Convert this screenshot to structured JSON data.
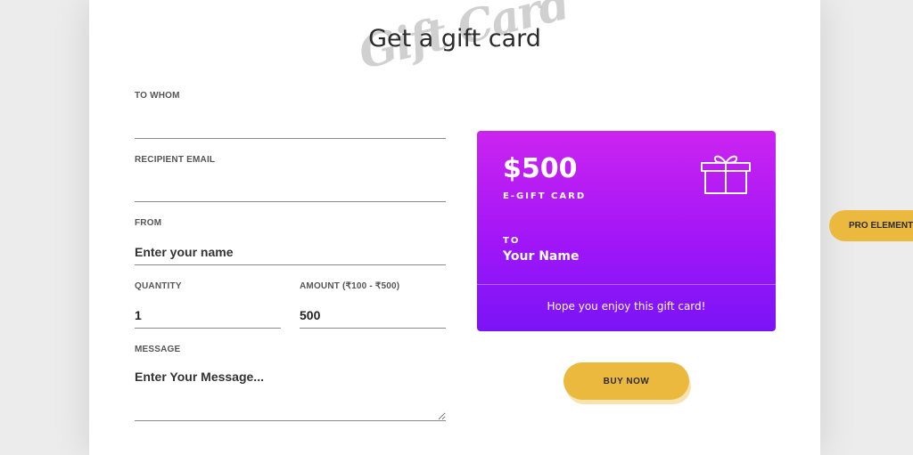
{
  "header": {
    "script_text": "Gift Card",
    "title": "Get a gift card"
  },
  "form": {
    "to_whom": {
      "label": "TO WHOM",
      "value": "",
      "placeholder": ""
    },
    "recipient_email": {
      "label": "RECIPIENT EMAIL",
      "value": "",
      "placeholder": ""
    },
    "from": {
      "label": "FROM",
      "value": "",
      "placeholder": "Enter your name"
    },
    "quantity": {
      "label": "QUANTITY",
      "value": "1"
    },
    "amount": {
      "label": "AMOUNT (₹100 - ₹500)",
      "value": "500"
    },
    "message": {
      "label": "MESSAGE",
      "value": "",
      "placeholder": "Enter Your Message..."
    }
  },
  "card": {
    "amount": "$500",
    "type_label": "E-GIFT CARD",
    "to_label": "TO",
    "recipient_name": "Your Name",
    "message": "Hope you enjoy this gift card!",
    "icon": "gift-icon",
    "gradient_top": "#cc24f0",
    "gradient_bottom": "#7a14f7"
  },
  "buy_button": {
    "label": "BUY NOW",
    "color": "#ecb93f"
  },
  "pro_badge": {
    "label": "PRO ELEMENT",
    "color": "#ecb93f"
  }
}
